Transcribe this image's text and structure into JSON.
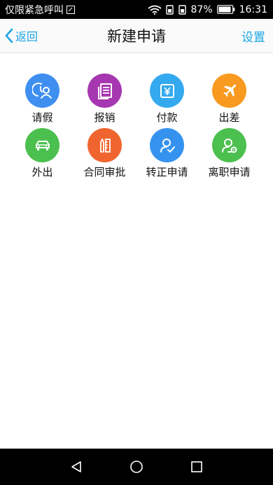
{
  "status_bar": {
    "carrier_text": "仅限紧急呼叫",
    "battery_percent": "87%",
    "time": "16:31"
  },
  "nav": {
    "back_label": "返回",
    "title": "新建申请",
    "settings_label": "设置"
  },
  "apps": [
    {
      "label": "请假",
      "icon": "leave-icon",
      "color": "#3f8ff0"
    },
    {
      "label": "报销",
      "icon": "reimburse-icon",
      "color": "#a637b0"
    },
    {
      "label": "付款",
      "icon": "payment-icon",
      "color": "#34a9ef"
    },
    {
      "label": "出差",
      "icon": "business-trip-icon",
      "color": "#f79a1f"
    },
    {
      "label": "外出",
      "icon": "outing-icon",
      "color": "#4cc04f"
    },
    {
      "label": "合同审批",
      "icon": "contract-icon",
      "color": "#f0652f"
    },
    {
      "label": "转正申请",
      "icon": "regularization-icon",
      "color": "#3593ef"
    },
    {
      "label": "离职申请",
      "icon": "resignation-icon",
      "color": "#4cc04f"
    }
  ]
}
